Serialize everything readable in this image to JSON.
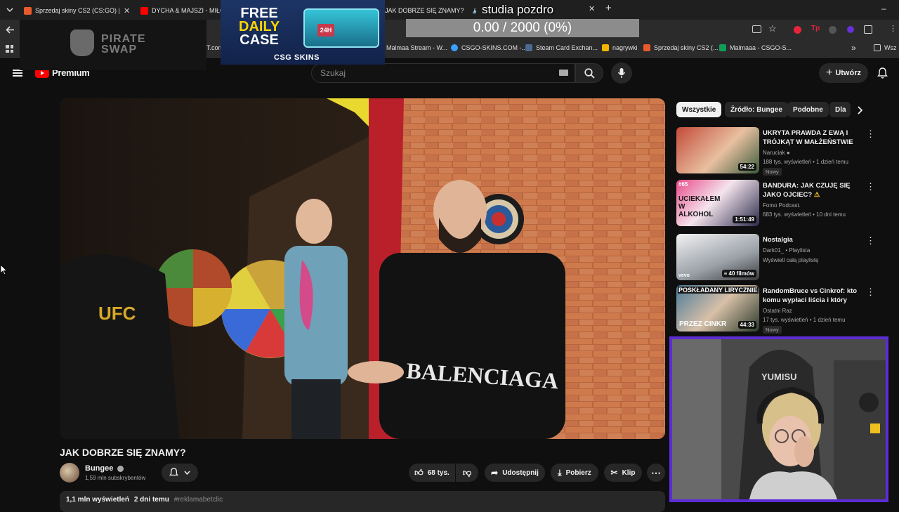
{
  "browser": {
    "tabs": [
      {
        "label": "Sprzedaj skiny CS2 (CS:GO) | N",
        "color": "#e85a2a"
      },
      {
        "label": "DYCHA & MAJSZI - MIŁOŚ",
        "color": "#ff0000"
      },
      {
        "label": "JAK DOBRZE SIĘ ZNAMY?",
        "color": "#ff0000"
      }
    ],
    "new_tab_label": "+",
    "bookmarks": [
      {
        "label": "Malmaa Stream - W...",
        "color": "#888888"
      },
      {
        "label": "CSGO-SKINS.COM -...",
        "color": "#3aa0ff"
      },
      {
        "label": "Steam Card Exchan...",
        "color": "#1b2838"
      },
      {
        "label": "nagrywki",
        "color": "#f4b400"
      },
      {
        "label": "Sprzedaj skiny CS2 (...",
        "color": "#e85a2a"
      },
      {
        "label": "Malmaaa - CSGO-S...",
        "color": "#0f9d58"
      }
    ],
    "bookmarks_more": "»",
    "bookmarks_folder": "Wsz",
    "truncated_bookmark": "T.com"
  },
  "overlays": {
    "pirate_logo_line1": "PIRATE",
    "pirate_logo_line2": "SWAP",
    "csgo_free": "FREE",
    "csgo_daily": "DAILY",
    "csgo_case": "CASE",
    "csgo_brand": "CSG SKINS",
    "csgo_24h": "24H",
    "goal_text": "0.00 / 2000 (0%)",
    "studio_text": "studia pozdro"
  },
  "youtube": {
    "logo_text": "Premium",
    "search_placeholder": "Szukaj",
    "create_label": "Utwórz",
    "accent": "#ff0000"
  },
  "video": {
    "title": "JAK DOBRZE SIĘ ZNAMY?",
    "channel": "Bungee",
    "subscribers": "1,59 mln subskrybentów",
    "likes": "68 tys.",
    "share_label": "Udostępnij",
    "download_label": "Pobierz",
    "clip_label": "Klip",
    "views": "1,1 mln wyświetleń",
    "age": "2 dni temu",
    "tag": "#reklamabetclic",
    "shirt_text": "BALENCIAGA",
    "hoodie_text": "UFC"
  },
  "chips": [
    {
      "label": "Wszystkie",
      "active": true
    },
    {
      "label": "Źródło: Bungee",
      "active": false
    },
    {
      "label": "Podobne",
      "active": false
    },
    {
      "label": "Dla",
      "active": false
    }
  ],
  "recommended": [
    {
      "title": "UKRYTA PRAWDA Z EWĄ I TRÓJKĄT W MAŁŻEŃSTWIE",
      "channel": "Naruciak",
      "stats": "188 tys. wyświetleń • 1 dzień temu",
      "badge": "Nowy",
      "duration": "54:22",
      "thumb_color": "#b5483c"
    },
    {
      "title": "BANDURA: JAK CZUJĘ SIĘ JAKO OJCIEC?",
      "channel": "Fomo Podcast.",
      "stats": "683 tys. wyświetleń • 10 dni temu",
      "badge": "",
      "duration": "1:51:49",
      "thumb_color": "#d83a7c",
      "thumb_text": "UCIEKAŁEM W ALKOHOL",
      "thumb_num": "#65"
    },
    {
      "title": "Nostalgia",
      "channel": "Dark01_ • Playlista",
      "stats": "Wyświetl całą playlistę",
      "badge": "",
      "duration": "40 filmów",
      "thumb_color": "#cfcfcf",
      "thumb_text": "vevo"
    },
    {
      "title": "RandomBruce vs Cinkrof: kto komu wypłaci liścia i który jest...",
      "channel": "Ostatni Raz",
      "stats": "17 tys. wyświetleń • 1 dzień temu",
      "badge": "Nowy",
      "duration": "44:33",
      "thumb_color": "#3b6a8a",
      "thumb_text": "POSKŁADANY LIRYCZNIE",
      "thumb_text2": "PRZEZ CINKR"
    }
  ],
  "webcam": {
    "chair_text": "YUMISU",
    "border_color": "#5c2cd6"
  }
}
